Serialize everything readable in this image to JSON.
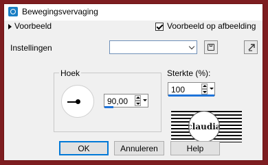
{
  "window": {
    "title": "Bewegingsvervaging"
  },
  "preview_toggle": {
    "label": "Voorbeeld"
  },
  "preview_on_image": {
    "label": "Voorbeeld op afbeelding",
    "checked": true
  },
  "settings": {
    "label": "Instellingen",
    "value": ""
  },
  "angle": {
    "group_label": "Hoek",
    "value": "90,00"
  },
  "strength": {
    "label": "Sterkte (%):",
    "value": "100"
  },
  "watermark": {
    "text": "claudia"
  },
  "buttons": {
    "ok": "OK",
    "cancel": "Annuleren",
    "help": "Help"
  },
  "icons": {
    "app": "app-icon",
    "save": "save-icon",
    "reset": "reset-icon",
    "expand": "expand-triangle-icon"
  },
  "colors": {
    "frame": "#7d1d20",
    "accent": "#1e73d9"
  }
}
